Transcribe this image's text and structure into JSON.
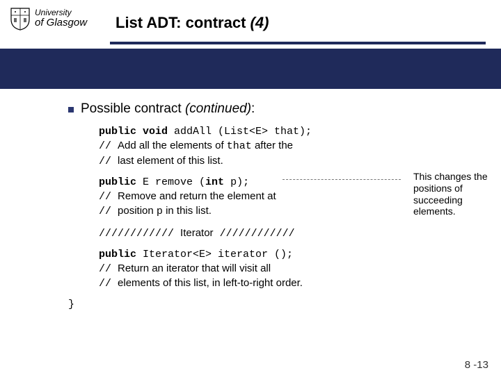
{
  "logo": {
    "line1": "University",
    "line2": "of Glasgow"
  },
  "title": {
    "pre": "List ADT: contract ",
    "ital": "(4)"
  },
  "bullet": {
    "pre": "Possible contract ",
    "ital": "(continued)",
    "post": ":"
  },
  "code": {
    "addAll_sig_pre": "public void ",
    "addAll_sig_name": "addAll (List<E> that);",
    "addAll_c1_pre": "// ",
    "addAll_c1_a": "Add all the elements of ",
    "addAll_c1_mono": "that",
    "addAll_c1_b": " after the",
    "addAll_c2_pre": "// ",
    "addAll_c2_txt": "last element of this list.",
    "remove_sig_pre": "public ",
    "remove_sig_mid1": "E",
    "remove_sig_mid2": " remove (",
    "remove_sig_kw": "int",
    "remove_sig_tail": " p);",
    "remove_c1_pre": "// ",
    "remove_c1_txt": "Remove and return the element at",
    "remove_c2_pre": "// ",
    "remove_c2_a": "position ",
    "remove_c2_mono": "p",
    "remove_c2_b": " in this list.",
    "iterhdr_a": "//////////// ",
    "iterhdr_txt": "Iterator",
    "iterhdr_b": " ////////////",
    "iter_sig_pre": "public ",
    "iter_sig_name": "Iterator<E> iterator ();",
    "iter_c1_pre": "// ",
    "iter_c1_txt": "Return an iterator that will visit all",
    "iter_c2_pre": "// ",
    "iter_c2_txt": "elements of this list, in left-to-right order.",
    "brace": "}"
  },
  "note": "This changes the positions of succeeding elements.",
  "page": "8 -13"
}
